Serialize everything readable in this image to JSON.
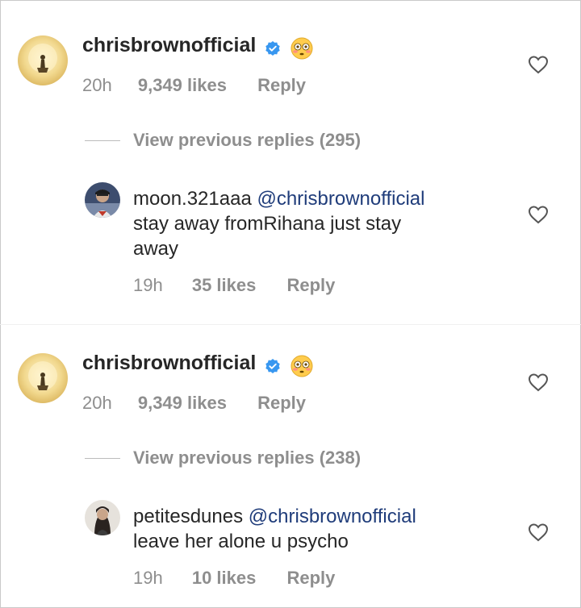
{
  "threads": [
    {
      "comment": {
        "username": "chrisbrownofficial",
        "time": "20h",
        "likes": "9,349 likes",
        "reply": "Reply"
      },
      "view_previous": "View previous replies (295)",
      "reply": {
        "username": "moon.321aaa",
        "mention": "@chrisbrownofficial",
        "text_line1": "stay away fromRihana just stay",
        "text_line2": "away",
        "time": "19h",
        "likes": "35 likes",
        "reply": "Reply"
      }
    },
    {
      "comment": {
        "username": "chrisbrownofficial",
        "time": "20h",
        "likes": "9,349 likes",
        "reply": "Reply"
      },
      "view_previous": "View previous replies (238)",
      "reply": {
        "username": "petitesdunes",
        "mention": "@chrisbrownofficial",
        "text_line1": "leave her alone u psycho",
        "time": "19h",
        "likes": "10 likes",
        "reply": "Reply"
      }
    }
  ],
  "colors": {
    "mention": "#1f3c7a",
    "verified": "#3897f0",
    "muted": "#8e8e8e"
  }
}
